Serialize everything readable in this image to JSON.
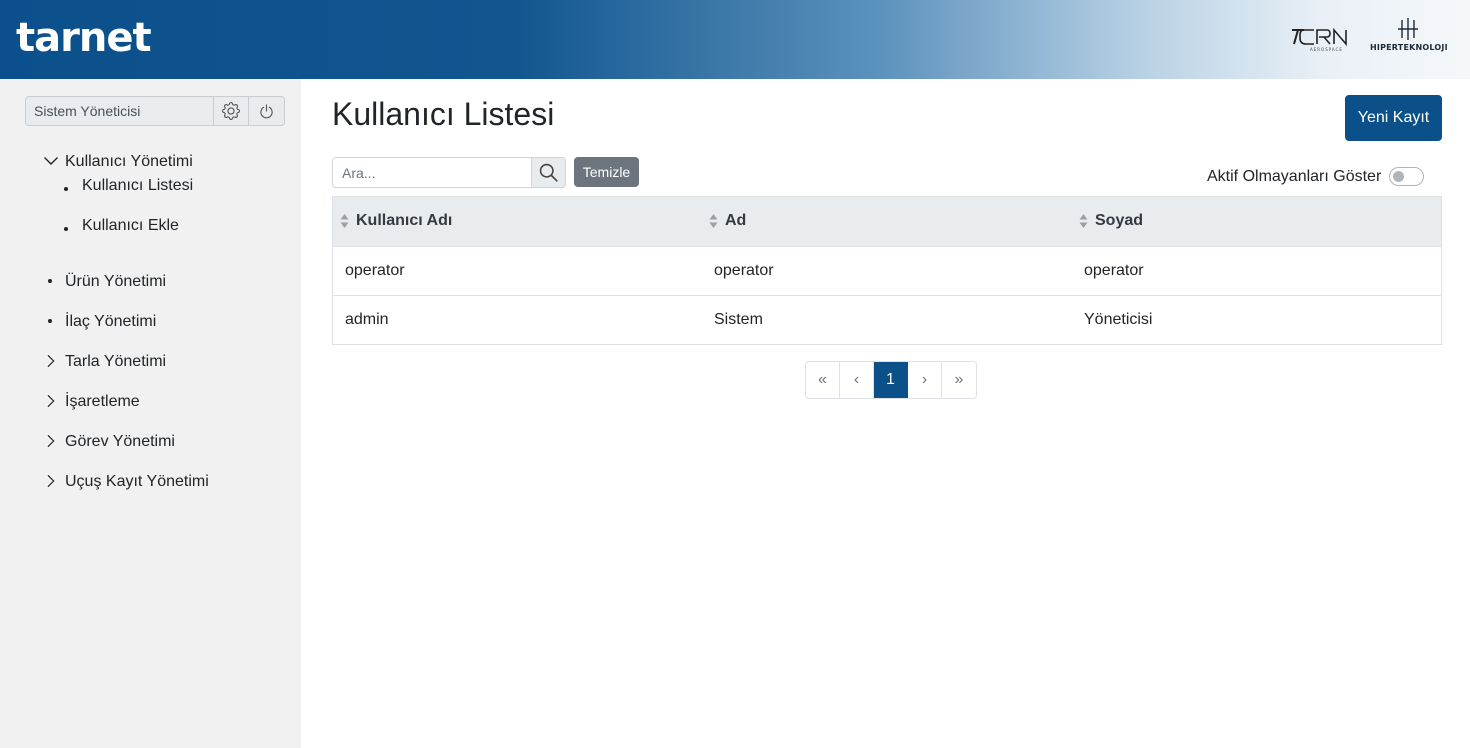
{
  "header": {
    "brand": "tarnet",
    "partner1_alt": "CRN AEROSPACE",
    "partner2_name": "HIPERTEKNOLOJI",
    "colors": {
      "primary": "#0c5089"
    }
  },
  "sidebar": {
    "user_name": "Sistem Yöneticisi",
    "settings_icon": "gear-icon",
    "logout_icon": "power-icon",
    "menu": [
      {
        "label": "Kullanıcı Yönetimi",
        "icon": "chevron-down-icon",
        "expanded": true,
        "children": [
          {
            "label": "Kullanıcı Listesi"
          },
          {
            "label": "Kullanıcı Ekle"
          }
        ]
      },
      {
        "label": "Ürün Yönetimi",
        "icon": "bullet"
      },
      {
        "label": "İlaç Yönetimi",
        "icon": "bullet"
      },
      {
        "label": "Tarla Yönetimi",
        "icon": "chevron-right-icon"
      },
      {
        "label": "İşaretleme",
        "icon": "chevron-right-icon"
      },
      {
        "label": "Görev Yönetimi",
        "icon": "chevron-right-icon"
      },
      {
        "label": "Uçuş Kayıt Yönetimi",
        "icon": "chevron-right-icon"
      }
    ]
  },
  "main": {
    "title": "Kullanıcı Listesi",
    "new_button": "Yeni Kayıt",
    "search": {
      "placeholder": "Ara...",
      "value": ""
    },
    "clear_button": "Temizle",
    "toggle_label": "Aktif Olmayanları Göster",
    "toggle_on": false,
    "table": {
      "columns": [
        "Kullanıcı Adı",
        "Ad",
        "Soyad"
      ],
      "rows": [
        [
          "operator",
          "operator",
          "operator"
        ],
        [
          "admin",
          "Sistem",
          "Yöneticisi"
        ]
      ]
    },
    "pagination": {
      "first": "«",
      "prev": "‹",
      "current": "1",
      "next": "›",
      "last": "»"
    }
  }
}
